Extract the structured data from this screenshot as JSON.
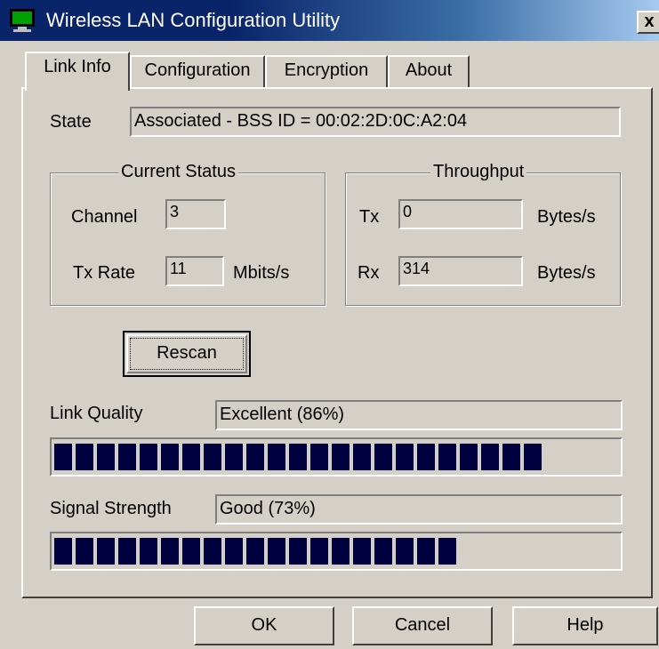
{
  "window": {
    "title": "Wireless LAN Configuration Utility",
    "close_label": "x",
    "icon": "monitor-icon"
  },
  "tabs": [
    {
      "label": "Link Info",
      "active": true
    },
    {
      "label": "Configuration",
      "active": false
    },
    {
      "label": "Encryption",
      "active": false
    },
    {
      "label": "About",
      "active": false
    }
  ],
  "state": {
    "label": "State",
    "value": "Associated - BSS ID = 00:02:2D:0C:A2:04"
  },
  "current_status": {
    "title": "Current Status",
    "channel_label": "Channel",
    "channel_value": "3",
    "txrate_label": "Tx Rate",
    "txrate_value": "11",
    "txrate_unit": "Mbits/s"
  },
  "throughput": {
    "title": "Throughput",
    "tx_label": "Tx",
    "tx_value": "0",
    "tx_unit": "Bytes/s",
    "rx_label": "Rx",
    "rx_value": "314",
    "rx_unit": "Bytes/s"
  },
  "rescan_label": "Rescan",
  "link_quality": {
    "label": "Link Quality",
    "value": "Excellent (86%)",
    "percent": 86
  },
  "signal_strength": {
    "label": "Signal Strength",
    "value": "Good (73%)",
    "percent": 73
  },
  "buttons": {
    "ok": "OK",
    "cancel": "Cancel",
    "help": "Help"
  },
  "colors": {
    "title_bar": "#0a246a",
    "bar_block": "#000040",
    "dialog_face": "#d4d0c8"
  }
}
